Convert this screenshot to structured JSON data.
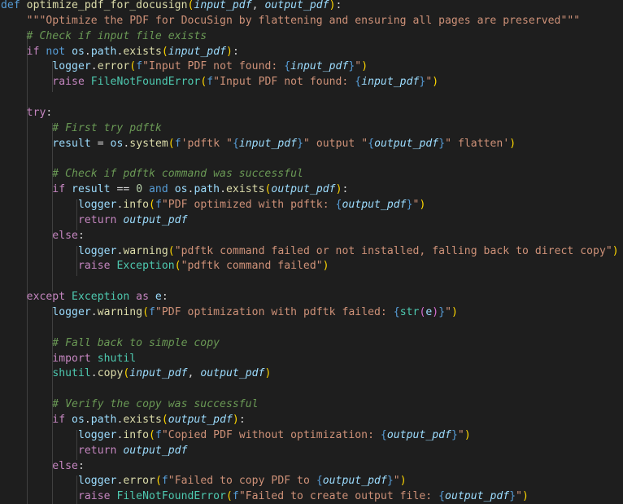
{
  "editor": {
    "language": "python",
    "lines": [
      [
        [
          "kw",
          "def "
        ],
        [
          "fn",
          "optimize_pdf_for_docusign"
        ],
        [
          "p1",
          "("
        ],
        [
          "param",
          "input_pdf"
        ],
        [
          "op",
          ", "
        ],
        [
          "param",
          "output_pdf"
        ],
        [
          "p1",
          ")"
        ],
        [
          "op",
          ":"
        ]
      ],
      [
        [
          "doc",
          "    \"\"\"Optimize the PDF for DocuSign by flattening and ensuring all pages are preserved\"\"\""
        ]
      ],
      [
        [
          "cmt",
          "    # Check if input file exists"
        ]
      ],
      [
        [
          "ctrl",
          "    if "
        ],
        [
          "kw",
          "not "
        ],
        [
          "var",
          "os"
        ],
        [
          "op",
          "."
        ],
        [
          "attr",
          "path"
        ],
        [
          "op",
          "."
        ],
        [
          "fn",
          "exists"
        ],
        [
          "p1",
          "("
        ],
        [
          "param",
          "input_pdf"
        ],
        [
          "p1",
          ")"
        ],
        [
          "op",
          ":"
        ]
      ],
      [
        [
          "plain",
          "        "
        ],
        [
          "var",
          "logger"
        ],
        [
          "op",
          "."
        ],
        [
          "fn",
          "error"
        ],
        [
          "p1",
          "("
        ],
        [
          "fstr",
          "f"
        ],
        [
          "str",
          "\"Input PDF not found: "
        ],
        [
          "brace",
          "{"
        ],
        [
          "param",
          "input_pdf"
        ],
        [
          "brace",
          "}"
        ],
        [
          "str",
          "\""
        ],
        [
          "p1",
          ")"
        ]
      ],
      [
        [
          "ctrl",
          "        raise "
        ],
        [
          "cls",
          "FileNotFoundError"
        ],
        [
          "p1",
          "("
        ],
        [
          "fstr",
          "f"
        ],
        [
          "str",
          "\"Input PDF not found: "
        ],
        [
          "brace",
          "{"
        ],
        [
          "param",
          "input_pdf"
        ],
        [
          "brace",
          "}"
        ],
        [
          "str",
          "\""
        ],
        [
          "p1",
          ")"
        ]
      ],
      [],
      [
        [
          "ctrl",
          "    try"
        ],
        [
          "op",
          ":"
        ]
      ],
      [
        [
          "cmt",
          "        # First try pdftk"
        ]
      ],
      [
        [
          "plain",
          "        "
        ],
        [
          "var",
          "result"
        ],
        [
          "op",
          " = "
        ],
        [
          "var",
          "os"
        ],
        [
          "op",
          "."
        ],
        [
          "fn",
          "system"
        ],
        [
          "p1",
          "("
        ],
        [
          "fstr",
          "f"
        ],
        [
          "str",
          "'pdftk \""
        ],
        [
          "brace",
          "{"
        ],
        [
          "param",
          "input_pdf"
        ],
        [
          "brace",
          "}"
        ],
        [
          "str",
          "\" output \""
        ],
        [
          "brace",
          "{"
        ],
        [
          "param",
          "output_pdf"
        ],
        [
          "brace",
          "}"
        ],
        [
          "str",
          "\" flatten'"
        ],
        [
          "p1",
          ")"
        ]
      ],
      [],
      [
        [
          "cmt",
          "        # Check if pdftk command was successful"
        ]
      ],
      [
        [
          "ctrl",
          "        if "
        ],
        [
          "var",
          "result"
        ],
        [
          "op",
          " == "
        ],
        [
          "num",
          "0"
        ],
        [
          "kw",
          " and "
        ],
        [
          "var",
          "os"
        ],
        [
          "op",
          "."
        ],
        [
          "attr",
          "path"
        ],
        [
          "op",
          "."
        ],
        [
          "fn",
          "exists"
        ],
        [
          "p1",
          "("
        ],
        [
          "param",
          "output_pdf"
        ],
        [
          "p1",
          ")"
        ],
        [
          "op",
          ":"
        ]
      ],
      [
        [
          "plain",
          "            "
        ],
        [
          "var",
          "logger"
        ],
        [
          "op",
          "."
        ],
        [
          "fn",
          "info"
        ],
        [
          "p1",
          "("
        ],
        [
          "fstr",
          "f"
        ],
        [
          "str",
          "\"PDF optimized with pdftk: "
        ],
        [
          "brace",
          "{"
        ],
        [
          "param",
          "output_pdf"
        ],
        [
          "brace",
          "}"
        ],
        [
          "str",
          "\""
        ],
        [
          "p1",
          ")"
        ]
      ],
      [
        [
          "ctrl",
          "            return "
        ],
        [
          "param",
          "output_pdf"
        ]
      ],
      [
        [
          "ctrl",
          "        else"
        ],
        [
          "op",
          ":"
        ]
      ],
      [
        [
          "plain",
          "            "
        ],
        [
          "var",
          "logger"
        ],
        [
          "op",
          "."
        ],
        [
          "fn",
          "warning"
        ],
        [
          "p1",
          "("
        ],
        [
          "str",
          "\"pdftk command failed or not installed, falling back to direct copy\""
        ],
        [
          "p1",
          ")"
        ]
      ],
      [
        [
          "ctrl",
          "            raise "
        ],
        [
          "cls",
          "Exception"
        ],
        [
          "p1",
          "("
        ],
        [
          "str",
          "\"pdftk command failed\""
        ],
        [
          "p1",
          ")"
        ]
      ],
      [],
      [
        [
          "ctrl",
          "    except "
        ],
        [
          "cls",
          "Exception"
        ],
        [
          "ctrl",
          " as "
        ],
        [
          "var",
          "e"
        ],
        [
          "op",
          ":"
        ]
      ],
      [
        [
          "plain",
          "        "
        ],
        [
          "var",
          "logger"
        ],
        [
          "op",
          "."
        ],
        [
          "fn",
          "warning"
        ],
        [
          "p1",
          "("
        ],
        [
          "fstr",
          "f"
        ],
        [
          "str",
          "\"PDF optimization with pdftk failed: "
        ],
        [
          "brace",
          "{"
        ],
        [
          "cls",
          "str"
        ],
        [
          "p2",
          "("
        ],
        [
          "var",
          "e"
        ],
        [
          "p2",
          ")"
        ],
        [
          "brace",
          "}"
        ],
        [
          "str",
          "\""
        ],
        [
          "p1",
          ")"
        ]
      ],
      [],
      [
        [
          "cmt",
          "        # Fall back to simple copy"
        ]
      ],
      [
        [
          "ctrl",
          "        import "
        ],
        [
          "cls",
          "shutil"
        ]
      ],
      [
        [
          "plain",
          "        "
        ],
        [
          "cls",
          "shutil"
        ],
        [
          "op",
          "."
        ],
        [
          "fn",
          "copy"
        ],
        [
          "p1",
          "("
        ],
        [
          "param",
          "input_pdf"
        ],
        [
          "op",
          ", "
        ],
        [
          "param",
          "output_pdf"
        ],
        [
          "p1",
          ")"
        ]
      ],
      [],
      [
        [
          "cmt",
          "        # Verify the copy was successful"
        ]
      ],
      [
        [
          "ctrl",
          "        if "
        ],
        [
          "var",
          "os"
        ],
        [
          "op",
          "."
        ],
        [
          "attr",
          "path"
        ],
        [
          "op",
          "."
        ],
        [
          "fn",
          "exists"
        ],
        [
          "p1",
          "("
        ],
        [
          "param",
          "output_pdf"
        ],
        [
          "p1",
          ")"
        ],
        [
          "op",
          ":"
        ]
      ],
      [
        [
          "plain",
          "            "
        ],
        [
          "var",
          "logger"
        ],
        [
          "op",
          "."
        ],
        [
          "fn",
          "info"
        ],
        [
          "p1",
          "("
        ],
        [
          "fstr",
          "f"
        ],
        [
          "str",
          "\"Copied PDF without optimization: "
        ],
        [
          "brace",
          "{"
        ],
        [
          "param",
          "output_pdf"
        ],
        [
          "brace",
          "}"
        ],
        [
          "str",
          "\""
        ],
        [
          "p1",
          ")"
        ]
      ],
      [
        [
          "ctrl",
          "            return "
        ],
        [
          "param",
          "output_pdf"
        ]
      ],
      [
        [
          "ctrl",
          "        else"
        ],
        [
          "op",
          ":"
        ]
      ],
      [
        [
          "plain",
          "            "
        ],
        [
          "var",
          "logger"
        ],
        [
          "op",
          "."
        ],
        [
          "fn",
          "error"
        ],
        [
          "p1",
          "("
        ],
        [
          "fstr",
          "f"
        ],
        [
          "str",
          "\"Failed to copy PDF to "
        ],
        [
          "brace",
          "{"
        ],
        [
          "param",
          "output_pdf"
        ],
        [
          "brace",
          "}"
        ],
        [
          "str",
          "\""
        ],
        [
          "p1",
          ")"
        ]
      ],
      [
        [
          "ctrl",
          "            raise "
        ],
        [
          "cls",
          "FileNotFoundError"
        ],
        [
          "p1",
          "("
        ],
        [
          "fstr",
          "f"
        ],
        [
          "str",
          "\"Failed to create output file: "
        ],
        [
          "brace",
          "{"
        ],
        [
          "param",
          "output_pdf"
        ],
        [
          "brace",
          "}"
        ],
        [
          "str",
          "\""
        ],
        [
          "p1",
          ")"
        ]
      ]
    ]
  },
  "colors": {
    "background": "#1e1e1e",
    "keyword": "#569cd6",
    "control": "#c586c0",
    "function": "#dcdcaa",
    "parameter": "#9cdcfe",
    "string": "#ce9178",
    "comment": "#6a9955",
    "number": "#b5cea8",
    "class": "#4ec9b0",
    "bracket_level_1": "#ffd700",
    "bracket_level_2": "#da70d6"
  }
}
